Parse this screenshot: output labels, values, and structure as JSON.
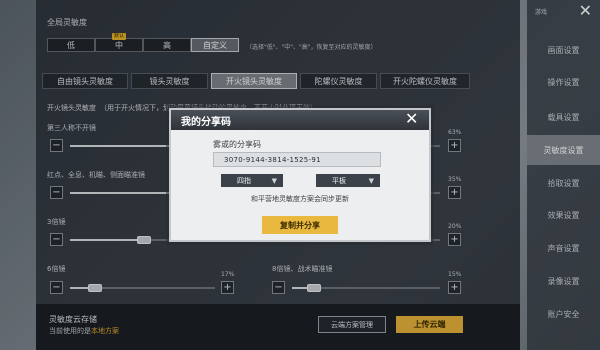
{
  "global_sensitivity": {
    "title": "全局灵敏度",
    "options": [
      {
        "label": "低",
        "selected": false
      },
      {
        "label": "中",
        "selected": false,
        "badge": "默认"
      },
      {
        "label": "高",
        "selected": false
      },
      {
        "label": "自定义",
        "selected": true
      }
    ],
    "hint": "（选择\"低\"、\"中\"、\"高\"，恢复至对应的灵敏度）"
  },
  "tabs": [
    {
      "label": "自由镜头灵敏度",
      "active": false
    },
    {
      "label": "镜头灵敏度",
      "active": false
    },
    {
      "label": "开火镜头灵敏度",
      "active": true
    },
    {
      "label": "陀螺仪灵敏度",
      "active": false
    },
    {
      "label": "开火陀螺仪灵敏度",
      "active": false
    }
  ],
  "section": {
    "title": "开火镜头灵敏度",
    "subtitle": "（用于开火情况下，划动屏幕镜头转动的灵敏度，不开火时此项无效）"
  },
  "sliders": [
    {
      "label": "第三人称不开镜",
      "value_text": "63%",
      "value": 0.63
    },
    {
      "label": "红点、全息、机瞄、侧面瞄准镜",
      "value_text": "35%",
      "value": 0.35
    },
    {
      "label": "3倍镜",
      "value_text": "20%",
      "value": 0.2
    },
    {
      "label": "6倍镜",
      "value_text": "17%",
      "value": 0.17
    },
    {
      "label": "8倍镜、战术瞄准镜",
      "value_text": "15%",
      "value": 0.15
    }
  ],
  "cloud": {
    "title": "灵敏度云存储",
    "current_prefix": "当前使用的是",
    "current_value": "本地方案",
    "manage_label": "云端方案管理",
    "upload_label": "上传云端"
  },
  "sidebar": {
    "top_label": "游戏",
    "items": [
      {
        "label": "画面设置",
        "active": false
      },
      {
        "label": "操作设置",
        "active": false
      },
      {
        "label": "载具设置",
        "active": false
      },
      {
        "label": "灵敏度设置",
        "active": true
      },
      {
        "label": "拾取设置",
        "active": false
      },
      {
        "label": "效果设置",
        "active": false
      },
      {
        "label": "声音设置",
        "active": false
      },
      {
        "label": "录像设置",
        "active": false
      },
      {
        "label": "账户安全",
        "active": false
      }
    ]
  },
  "modal": {
    "title": "我的分享码",
    "code_label": "雾或的分享码",
    "code": "3070-9144-3814-1525-91",
    "mode_value": "四指",
    "device_value": "平板",
    "note": "和平营地灵敏度方案会同步更新",
    "button_label": "复制并分享"
  },
  "colors": {
    "accent": "#e4b33a",
    "highlight_text": "#e3a82e"
  }
}
